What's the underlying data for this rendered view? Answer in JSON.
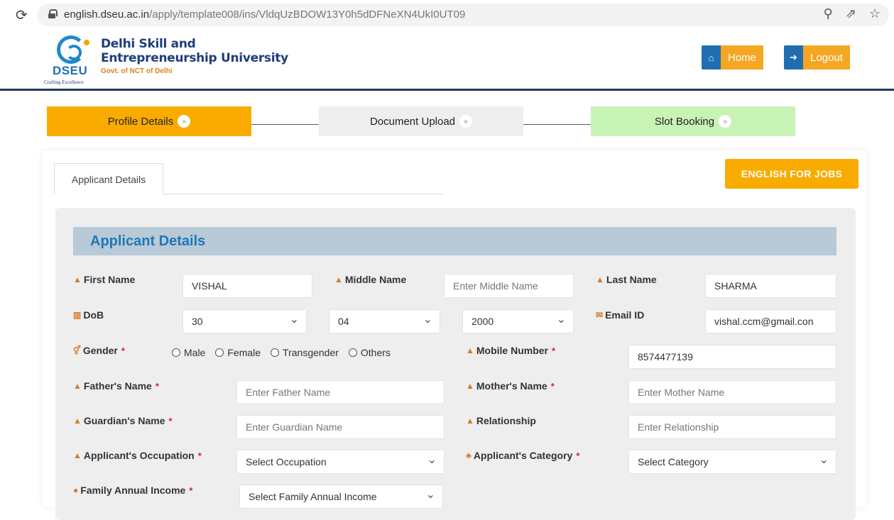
{
  "browser": {
    "url_host": "english.dseu.ac.in",
    "url_path": "/apply/template008/ins/VldqUzBDOW13Y0h5dDFNeXN4UkI0UT09"
  },
  "header": {
    "logo_text": "DSEU",
    "logo_tagline": "Crafting Excellence",
    "name_line1": "Delhi Skill and",
    "name_line2": "Entrepreneurship University",
    "gov_text": "Govt. of NCT of Delhi",
    "home_label": "Home",
    "logout_label": "Logout"
  },
  "steps": [
    {
      "label": "Profile Details"
    },
    {
      "label": "Document Upload"
    },
    {
      "label": "Slot Booking"
    }
  ],
  "tab_label": "Applicant Details",
  "jobs_button": "ENGLISH FOR JOBS",
  "section_title": "Applicant Details",
  "form": {
    "first_name_label": "First Name",
    "first_name_value": "VISHAL",
    "middle_name_label": "Middle Name",
    "middle_name_placeholder": "Enter Middle Name",
    "last_name_label": "Last Name",
    "last_name_value": "SHARMA",
    "dob_label": "DoB",
    "dob_day": "30",
    "dob_month": "04",
    "dob_year": "2000",
    "email_label": "Email ID",
    "email_value": "vishal.ccm@gmail.con",
    "gender_label": "Gender",
    "gender_options": [
      "Male",
      "Female",
      "Transgender",
      "Others"
    ],
    "mobile_label": "Mobile Number",
    "mobile_value": "8574477139",
    "father_label": "Father's Name",
    "father_placeholder": "Enter Father Name",
    "mother_label": "Mother's Name",
    "mother_placeholder": "Enter Mother Name",
    "guardian_label": "Guardian's Name",
    "guardian_placeholder": "Enter Guardian Name",
    "relationship_label": "Relationship",
    "relationship_placeholder": "Enter Relationship",
    "occupation_label": "Applicant's Occupation",
    "occupation_value": "Select Occupation",
    "category_label": "Applicant's Category",
    "category_value": "Select Category",
    "income_label": "Family Annual Income",
    "income_value": "Select Family Annual Income"
  }
}
